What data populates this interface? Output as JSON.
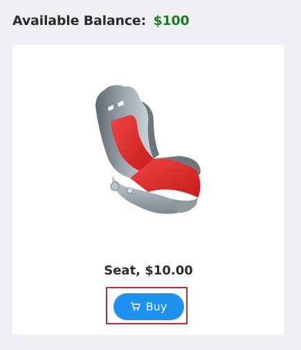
{
  "balance": {
    "label": "Available Balance:",
    "amount": "$100"
  },
  "product": {
    "image_alt": "Seat",
    "title": "Seat, $10.00",
    "buy_label": "Buy",
    "buy_icon": "cart-icon"
  },
  "colors": {
    "balance_amount": "#1f7a1f",
    "buy_button": "#1e90ee",
    "highlight_border": "#d0222f"
  }
}
